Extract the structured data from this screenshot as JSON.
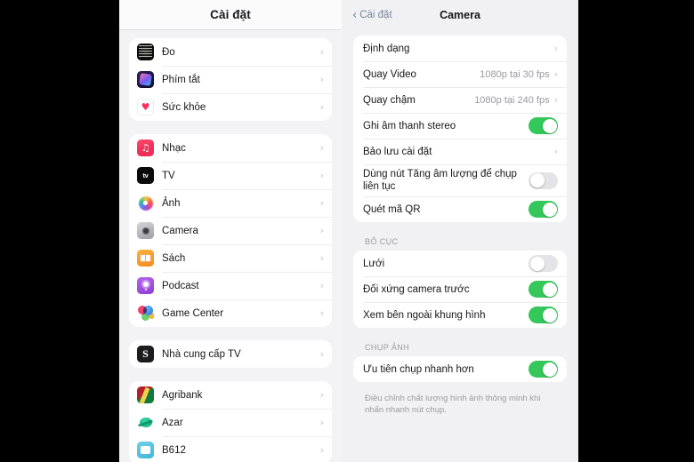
{
  "sidebar": {
    "title": "Cài đặt",
    "groups": [
      {
        "items": [
          {
            "label": "Đo",
            "icon": "measure-icon",
            "icon_class": "ic-do"
          },
          {
            "label": "Phím tắt",
            "icon": "shortcuts-icon",
            "icon_class": "ic-shortcut"
          },
          {
            "label": "Sức khỏe",
            "icon": "health-icon",
            "icon_class": "ic-health"
          }
        ]
      },
      {
        "items": [
          {
            "label": "Nhạc",
            "icon": "music-icon",
            "icon_class": "ic-music"
          },
          {
            "label": "TV",
            "icon": "tv-icon",
            "icon_class": "ic-tv"
          },
          {
            "label": "Ảnh",
            "icon": "photos-icon",
            "icon_class": "ic-photos"
          },
          {
            "label": "Camera",
            "icon": "camera-icon",
            "icon_class": "ic-camera"
          },
          {
            "label": "Sách",
            "icon": "books-icon",
            "icon_class": "ic-books"
          },
          {
            "label": "Podcast",
            "icon": "podcast-icon",
            "icon_class": "ic-podcast"
          },
          {
            "label": "Game Center",
            "icon": "game-center-icon",
            "icon_class": "ic-gc"
          }
        ]
      },
      {
        "items": [
          {
            "label": "Nhà cung cấp TV",
            "icon": "tv-provider-icon",
            "icon_class": "ic-tvprov"
          }
        ]
      },
      {
        "items": [
          {
            "label": "Agribank",
            "icon": "agribank-icon",
            "icon_class": "ic-agribank"
          },
          {
            "label": "Azar",
            "icon": "azar-icon",
            "icon_class": "ic-azar"
          },
          {
            "label": "B612",
            "icon": "b612-icon",
            "icon_class": "ic-b612"
          }
        ]
      }
    ],
    "chevron": "›"
  },
  "detail": {
    "back_label": "Cài đặt",
    "back_chevron": "‹",
    "title": "Camera",
    "sections": [
      {
        "header": "",
        "footer": "",
        "rows": [
          {
            "label": "Định dạng",
            "type": "disclosure",
            "value": "",
            "chevron": "›"
          },
          {
            "label": "Quay Video",
            "type": "disclosure",
            "value": "1080p tại 30 fps",
            "chevron": "›"
          },
          {
            "label": "Quay chậm",
            "type": "disclosure",
            "value": "1080p tại 240 fps",
            "chevron": "›"
          },
          {
            "label": "Ghi âm thanh stereo",
            "type": "toggle",
            "state": "on"
          },
          {
            "label": "Bảo lưu cài đặt",
            "type": "disclosure",
            "value": "",
            "chevron": "›"
          },
          {
            "label": "Dùng nút Tăng âm lượng để chụp liên tục",
            "type": "toggle",
            "state": "off"
          },
          {
            "label": "Quét mã QR",
            "type": "toggle",
            "state": "on"
          }
        ]
      },
      {
        "header": "BỐ CỤC",
        "footer": "",
        "rows": [
          {
            "label": "Lưới",
            "type": "toggle",
            "state": "off"
          },
          {
            "label": "Đối xứng camera trước",
            "type": "toggle",
            "state": "on"
          },
          {
            "label": "Xem bên ngoài khung hình",
            "type": "toggle",
            "state": "on"
          }
        ]
      },
      {
        "header": "CHỤP ẢNH",
        "footer": "Điều chỉnh chất lượng hình ảnh thông minh khi nhấn nhanh nút chụp.",
        "rows": [
          {
            "label": "Ưu tiên chụp nhanh hơn",
            "type": "toggle",
            "state": "on"
          }
        ]
      }
    ]
  },
  "colors": {
    "accent_green": "#34C759",
    "back_blue": "#76879B",
    "panel_bg": "#F1F1F4",
    "card_bg": "#FFFFFF",
    "letterbox": "#000000"
  }
}
